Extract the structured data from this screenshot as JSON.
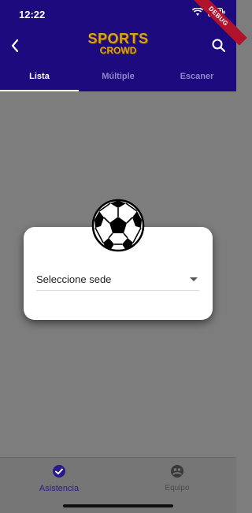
{
  "status_bar": {
    "time": "12:22"
  },
  "app_bar": {
    "logo_top": "SPORTS",
    "logo_bottom": "CROWD",
    "back_icon": "chevron-left-icon",
    "search_icon": "search-icon"
  },
  "debug_banner": "DEBUG",
  "tabs": [
    {
      "label": "Lista",
      "active": true
    },
    {
      "label": "Múltiple",
      "active": false
    },
    {
      "label": "Escaner",
      "active": false
    }
  ],
  "dialog": {
    "icon": "soccer-ball-icon",
    "select": {
      "value": "Seleccione sede"
    }
  },
  "bottom_nav": [
    {
      "label": "Asistencia",
      "icon": "check-circle-icon",
      "active": true
    },
    {
      "label": "Equipo",
      "icon": "team-icon",
      "active": false
    }
  ],
  "colors": {
    "primary": "#1d0a7e",
    "logo": "#d8a21b",
    "overlay": "#7d7d7d"
  }
}
